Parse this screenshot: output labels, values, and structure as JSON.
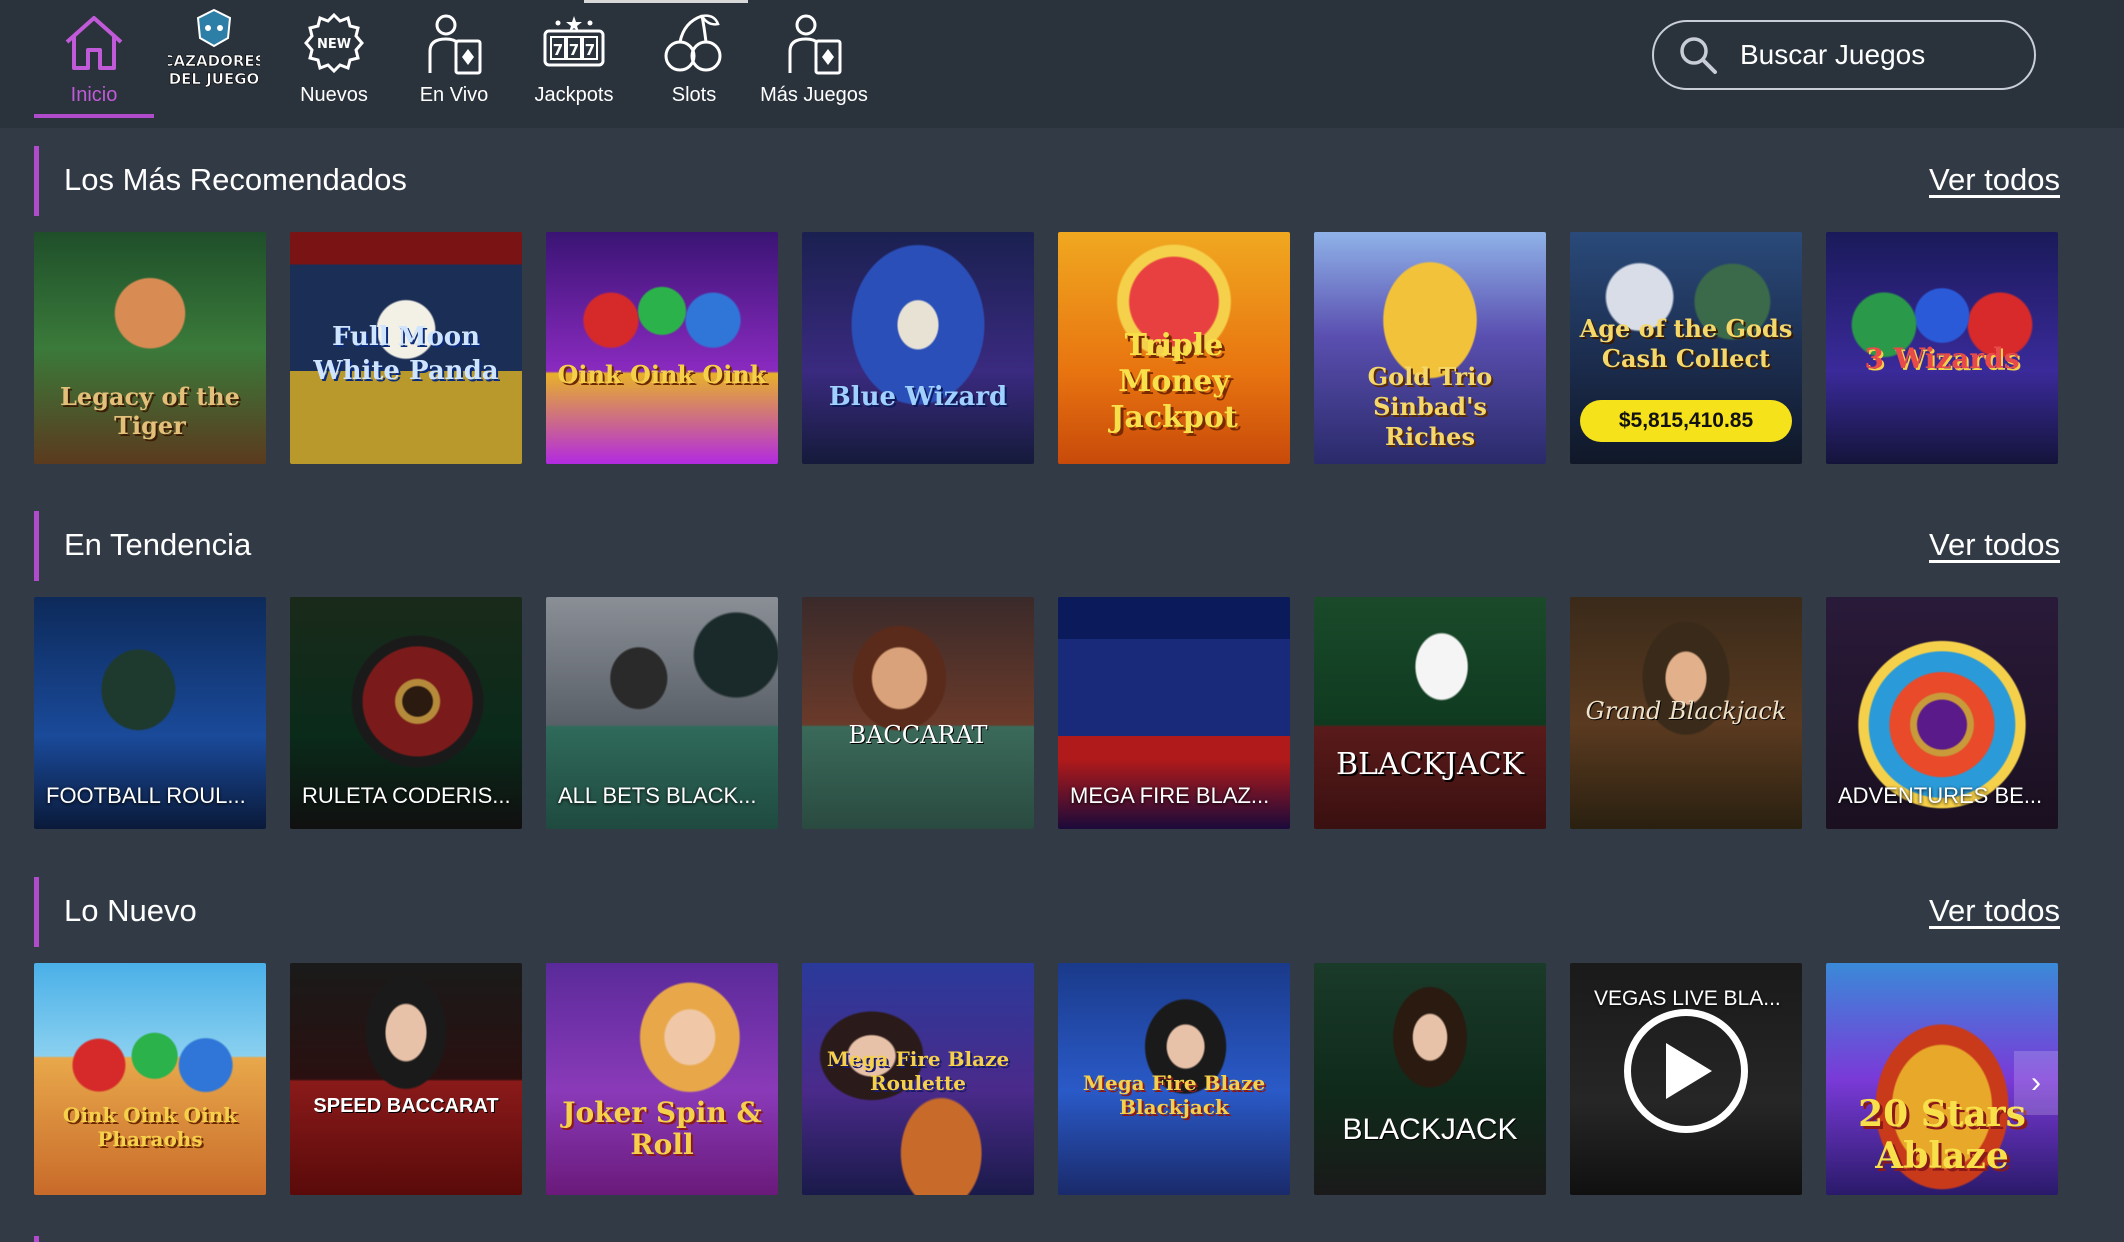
{
  "nav": {
    "items": [
      {
        "label": "Inicio",
        "icon": "home-icon",
        "active": true
      },
      {
        "label": "",
        "icon": "cazadores-del-juego-logo",
        "logo_text": [
          "CAZADORES",
          "DEL JUEGO"
        ]
      },
      {
        "label": "Nuevos",
        "icon": "new-badge-icon",
        "badge": "NEW"
      },
      {
        "label": "En Vivo",
        "icon": "live-dealer-icon"
      },
      {
        "label": "Jackpots",
        "icon": "slot-777-icon",
        "badge": "777"
      },
      {
        "label": "Slots",
        "icon": "cherries-icon"
      },
      {
        "label": "Más Juegos",
        "icon": "more-games-icon"
      }
    ]
  },
  "search": {
    "placeholder": "Buscar Juegos"
  },
  "colors": {
    "accent": "#b04ccc",
    "active_text": "#c05ad8",
    "background": "#313a45",
    "header": "#2a323c"
  },
  "sections": [
    {
      "title": "Los Más Recomendados",
      "link": "Ver todos",
      "games": [
        {
          "art": "Legacy of the Tiger"
        },
        {
          "art": "Full Moon White Panda"
        },
        {
          "art": "Oink Oink Oink"
        },
        {
          "art": "Blue Wizard"
        },
        {
          "art": "Triple Money Jackpot"
        },
        {
          "art": "Gold Trio Sinbad's Riches"
        },
        {
          "art": "Age of the Gods Cash Collect",
          "jackpot": "$5,815,410.85"
        },
        {
          "art": "3 Wizards"
        }
      ]
    },
    {
      "title": "En Tendencia",
      "link": "Ver todos",
      "games": [
        {
          "caption": "FOOTBALL ROUL..."
        },
        {
          "caption": "RULETA CODERIS..."
        },
        {
          "caption": "ALL BETS BLACK..."
        },
        {
          "art": "BACCARAT"
        },
        {
          "caption": "MEGA FIRE BLAZ..."
        },
        {
          "art": "BLACKJACK"
        },
        {
          "art": "Grand Blackjack"
        },
        {
          "caption": "ADVENTURES BE..."
        }
      ]
    },
    {
      "title": "Lo Nuevo",
      "link": "Ver todos",
      "games": [
        {
          "art": "Oink Oink Oink Pharaohs"
        },
        {
          "art": "SPEED BACCARAT"
        },
        {
          "art": "Joker Spin & Roll"
        },
        {
          "art": "Mega Fire Blaze Roulette"
        },
        {
          "art": "Mega Fire Blaze Blackjack"
        },
        {
          "art": "BLACKJACK"
        },
        {
          "caption": "VEGAS LIVE BLA...",
          "play": true
        },
        {
          "art": "20 Stars Ablaze"
        }
      ]
    }
  ]
}
